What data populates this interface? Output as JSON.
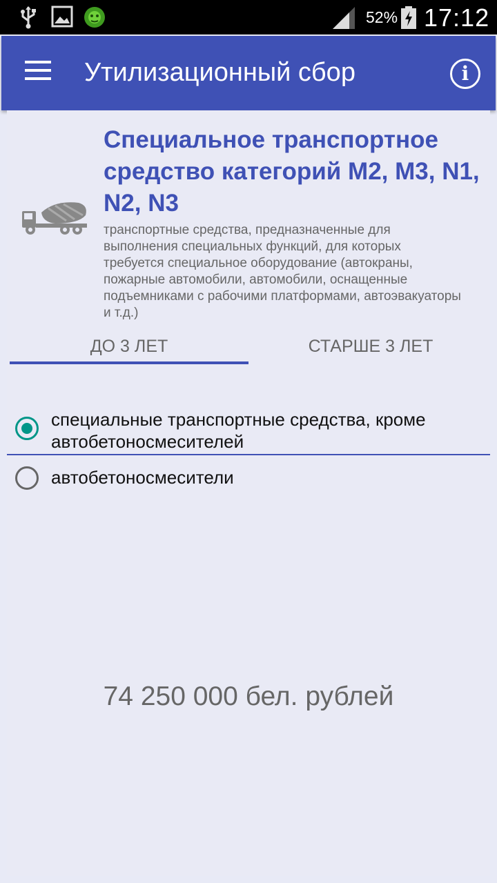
{
  "status_bar": {
    "battery_percent": "52%",
    "time": "17:12",
    "icons": [
      "usb-icon",
      "image-icon",
      "bug-icon",
      "signal-icon",
      "battery-charging-icon"
    ]
  },
  "app_bar": {
    "title": "Утилизационный сбор",
    "menu_icon": "hamburger-menu-icon",
    "info_icon": "info-icon",
    "info_glyph": "i"
  },
  "category": {
    "title": "Специальное транспортное средство категорий M2, M3, N1, N2, N3",
    "description": "транспортные средства, предназначенные для выполнения специальных функций, для которых требуется специальное оборудование (автокраны, пожарные автомобили, автомобили, оснащенные подъемниками с рабочими платформами, автоэвакуаторы и т.д.)",
    "icon": "concrete-mixer-truck-icon"
  },
  "tabs": [
    {
      "label": "ДО 3 ЛЕТ",
      "selected": true
    },
    {
      "label": "СТАРШЕ 3 ЛЕТ",
      "selected": false
    }
  ],
  "options": [
    {
      "label": "специальные транспортные средства, кроме автобетоносмесителей",
      "selected": true
    },
    {
      "label": "автобетоносмесители",
      "selected": false
    }
  ],
  "result": "74 250 000 бел. рублей",
  "colors": {
    "primary": "#3f51b5",
    "accent": "#009688",
    "background": "#e8eaf6"
  }
}
